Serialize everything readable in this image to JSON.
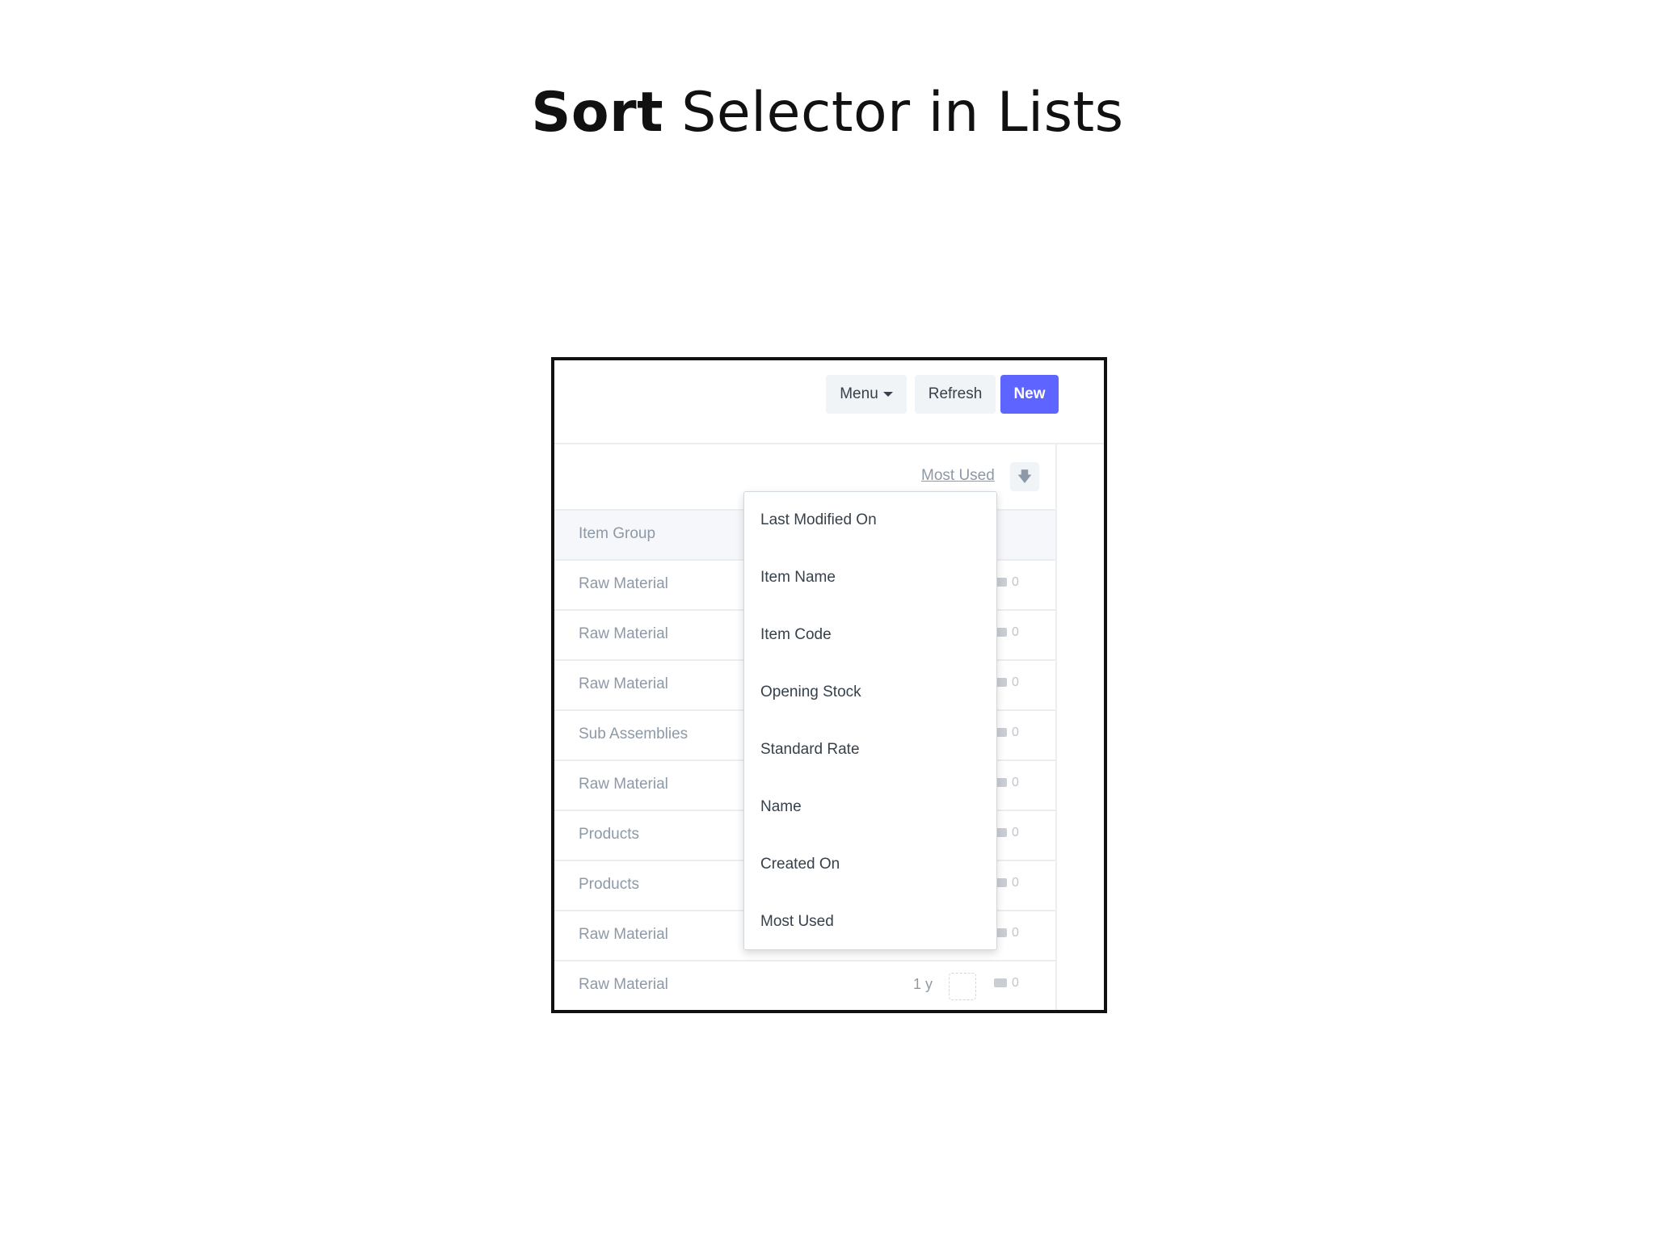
{
  "slide": {
    "title_bold": "Sort",
    "title_rest": " Selector in Lists"
  },
  "toolbar": {
    "menu_label": "Menu",
    "refresh_label": "Refresh",
    "new_label": "New",
    "accent_color": "#5e64ff"
  },
  "sort": {
    "current": "Most Used",
    "order_icon": "arrow-down-icon"
  },
  "table": {
    "header": "Item Group",
    "rows": [
      {
        "group": "Raw Material",
        "comments": "0"
      },
      {
        "group": "Raw Material",
        "comments": "0"
      },
      {
        "group": "Raw Material",
        "comments": "0"
      },
      {
        "group": "Sub Assemblies",
        "comments": "0"
      },
      {
        "group": "Raw Material",
        "comments": "0"
      },
      {
        "group": "Products",
        "comments": "0"
      },
      {
        "group": "Products",
        "comments": "0"
      },
      {
        "group": "Raw Material",
        "comments": "0"
      },
      {
        "group": "Raw Material",
        "modified": "1 y",
        "comments": "0"
      }
    ]
  },
  "dropdown": {
    "options": [
      "Last Modified On",
      "Item Name",
      "Item Code",
      "Opening Stock",
      "Standard Rate",
      "Name",
      "Created On",
      "Most Used"
    ]
  }
}
